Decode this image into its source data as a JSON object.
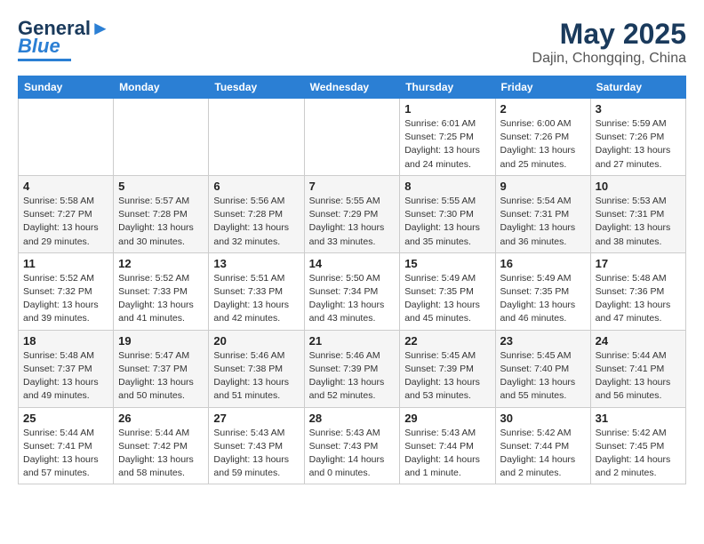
{
  "header": {
    "logo_line1": "General",
    "logo_line2": "Blue",
    "title": "May 2025",
    "subtitle": "Dajin, Chongqing, China"
  },
  "weekdays": [
    "Sunday",
    "Monday",
    "Tuesday",
    "Wednesday",
    "Thursday",
    "Friday",
    "Saturday"
  ],
  "weeks": [
    [
      {
        "day": "",
        "info": ""
      },
      {
        "day": "",
        "info": ""
      },
      {
        "day": "",
        "info": ""
      },
      {
        "day": "",
        "info": ""
      },
      {
        "day": "1",
        "info": "Sunrise: 6:01 AM\nSunset: 7:25 PM\nDaylight: 13 hours\nand 24 minutes."
      },
      {
        "day": "2",
        "info": "Sunrise: 6:00 AM\nSunset: 7:26 PM\nDaylight: 13 hours\nand 25 minutes."
      },
      {
        "day": "3",
        "info": "Sunrise: 5:59 AM\nSunset: 7:26 PM\nDaylight: 13 hours\nand 27 minutes."
      }
    ],
    [
      {
        "day": "4",
        "info": "Sunrise: 5:58 AM\nSunset: 7:27 PM\nDaylight: 13 hours\nand 29 minutes."
      },
      {
        "day": "5",
        "info": "Sunrise: 5:57 AM\nSunset: 7:28 PM\nDaylight: 13 hours\nand 30 minutes."
      },
      {
        "day": "6",
        "info": "Sunrise: 5:56 AM\nSunset: 7:28 PM\nDaylight: 13 hours\nand 32 minutes."
      },
      {
        "day": "7",
        "info": "Sunrise: 5:55 AM\nSunset: 7:29 PM\nDaylight: 13 hours\nand 33 minutes."
      },
      {
        "day": "8",
        "info": "Sunrise: 5:55 AM\nSunset: 7:30 PM\nDaylight: 13 hours\nand 35 minutes."
      },
      {
        "day": "9",
        "info": "Sunrise: 5:54 AM\nSunset: 7:31 PM\nDaylight: 13 hours\nand 36 minutes."
      },
      {
        "day": "10",
        "info": "Sunrise: 5:53 AM\nSunset: 7:31 PM\nDaylight: 13 hours\nand 38 minutes."
      }
    ],
    [
      {
        "day": "11",
        "info": "Sunrise: 5:52 AM\nSunset: 7:32 PM\nDaylight: 13 hours\nand 39 minutes."
      },
      {
        "day": "12",
        "info": "Sunrise: 5:52 AM\nSunset: 7:33 PM\nDaylight: 13 hours\nand 41 minutes."
      },
      {
        "day": "13",
        "info": "Sunrise: 5:51 AM\nSunset: 7:33 PM\nDaylight: 13 hours\nand 42 minutes."
      },
      {
        "day": "14",
        "info": "Sunrise: 5:50 AM\nSunset: 7:34 PM\nDaylight: 13 hours\nand 43 minutes."
      },
      {
        "day": "15",
        "info": "Sunrise: 5:49 AM\nSunset: 7:35 PM\nDaylight: 13 hours\nand 45 minutes."
      },
      {
        "day": "16",
        "info": "Sunrise: 5:49 AM\nSunset: 7:35 PM\nDaylight: 13 hours\nand 46 minutes."
      },
      {
        "day": "17",
        "info": "Sunrise: 5:48 AM\nSunset: 7:36 PM\nDaylight: 13 hours\nand 47 minutes."
      }
    ],
    [
      {
        "day": "18",
        "info": "Sunrise: 5:48 AM\nSunset: 7:37 PM\nDaylight: 13 hours\nand 49 minutes."
      },
      {
        "day": "19",
        "info": "Sunrise: 5:47 AM\nSunset: 7:37 PM\nDaylight: 13 hours\nand 50 minutes."
      },
      {
        "day": "20",
        "info": "Sunrise: 5:46 AM\nSunset: 7:38 PM\nDaylight: 13 hours\nand 51 minutes."
      },
      {
        "day": "21",
        "info": "Sunrise: 5:46 AM\nSunset: 7:39 PM\nDaylight: 13 hours\nand 52 minutes."
      },
      {
        "day": "22",
        "info": "Sunrise: 5:45 AM\nSunset: 7:39 PM\nDaylight: 13 hours\nand 53 minutes."
      },
      {
        "day": "23",
        "info": "Sunrise: 5:45 AM\nSunset: 7:40 PM\nDaylight: 13 hours\nand 55 minutes."
      },
      {
        "day": "24",
        "info": "Sunrise: 5:44 AM\nSunset: 7:41 PM\nDaylight: 13 hours\nand 56 minutes."
      }
    ],
    [
      {
        "day": "25",
        "info": "Sunrise: 5:44 AM\nSunset: 7:41 PM\nDaylight: 13 hours\nand 57 minutes."
      },
      {
        "day": "26",
        "info": "Sunrise: 5:44 AM\nSunset: 7:42 PM\nDaylight: 13 hours\nand 58 minutes."
      },
      {
        "day": "27",
        "info": "Sunrise: 5:43 AM\nSunset: 7:43 PM\nDaylight: 13 hours\nand 59 minutes."
      },
      {
        "day": "28",
        "info": "Sunrise: 5:43 AM\nSunset: 7:43 PM\nDaylight: 14 hours\nand 0 minutes."
      },
      {
        "day": "29",
        "info": "Sunrise: 5:43 AM\nSunset: 7:44 PM\nDaylight: 14 hours\nand 1 minute."
      },
      {
        "day": "30",
        "info": "Sunrise: 5:42 AM\nSunset: 7:44 PM\nDaylight: 14 hours\nand 2 minutes."
      },
      {
        "day": "31",
        "info": "Sunrise: 5:42 AM\nSunset: 7:45 PM\nDaylight: 14 hours\nand 2 minutes."
      }
    ]
  ]
}
